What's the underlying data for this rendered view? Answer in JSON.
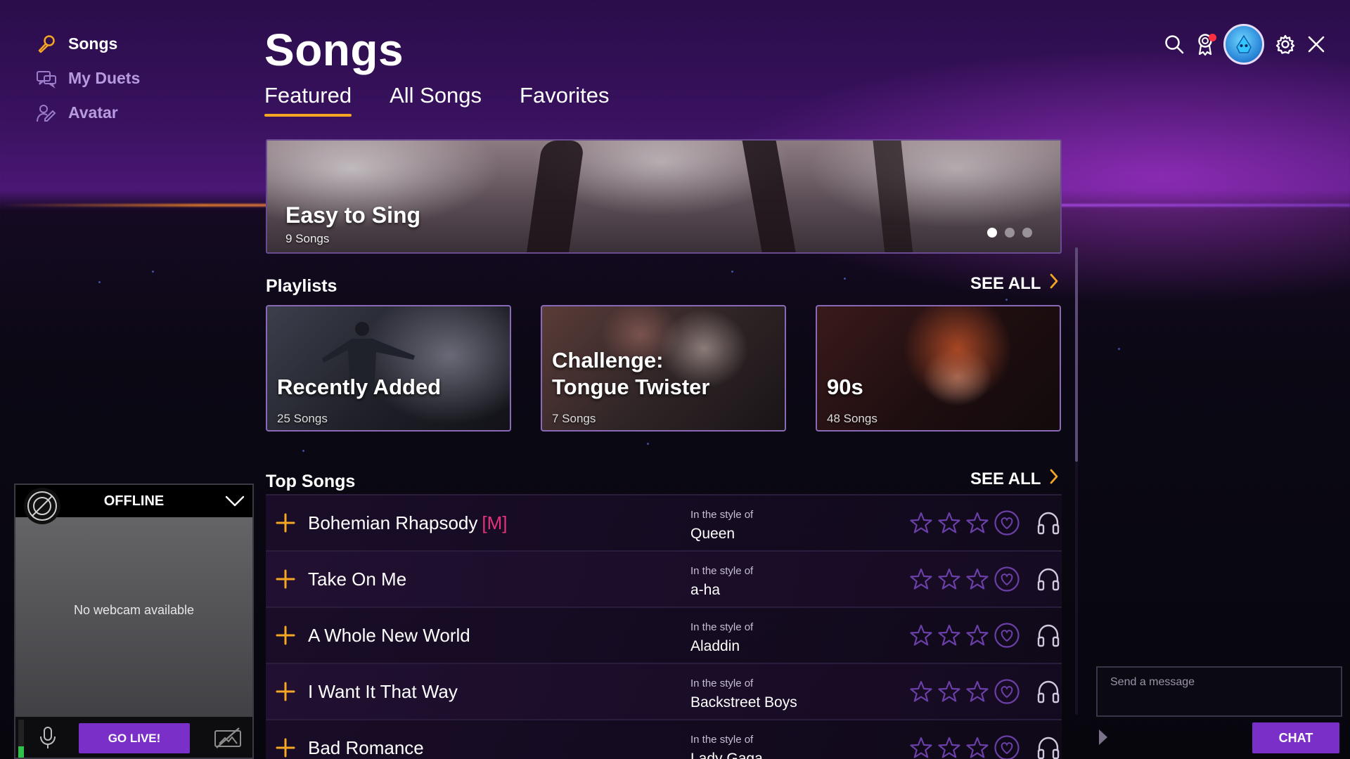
{
  "sidebar": {
    "items": [
      {
        "label": "Songs",
        "icon": "microphone-icon",
        "active": true
      },
      {
        "label": "My Duets",
        "icon": "duets-icon",
        "active": false
      },
      {
        "label": "Avatar",
        "icon": "avatar-edit-icon",
        "active": false
      }
    ]
  },
  "header": {
    "title": "Songs",
    "tabs": [
      {
        "label": "Featured",
        "active": true
      },
      {
        "label": "All Songs",
        "active": false
      },
      {
        "label": "Favorites",
        "active": false
      }
    ]
  },
  "toolbar": {
    "icons": [
      "search-icon",
      "achievements-icon",
      "profile-avatar",
      "settings-icon",
      "close-icon"
    ],
    "notification": true
  },
  "banner": {
    "title": "Easy to Sing",
    "subtitle": "9 Songs",
    "slide_count": 3,
    "active_slide": 1
  },
  "playlists": {
    "heading": "Playlists",
    "see_all": "SEE ALL",
    "cards": [
      {
        "title": "Recently Added",
        "subtitle": "25 Songs"
      },
      {
        "title_line1": "Challenge:",
        "title_line2": "Tongue Twister",
        "subtitle": "7 Songs"
      },
      {
        "title": "90s",
        "subtitle": "48 Songs"
      }
    ]
  },
  "top_songs": {
    "heading": "Top Songs",
    "see_all": "SEE ALL",
    "style_label": "In the style of",
    "rows": [
      {
        "title": "Bohemian Rhapsody",
        "tag": "[M]",
        "artist": "Queen"
      },
      {
        "title": "Take On Me",
        "tag": "",
        "artist": "a-ha"
      },
      {
        "title": "A Whole New World",
        "tag": "",
        "artist": "Aladdin"
      },
      {
        "title": "I Want It That Way",
        "tag": "",
        "artist": "Backstreet Boys"
      },
      {
        "title": "Bad Romance",
        "tag": "",
        "artist": "Lady Gaga"
      }
    ]
  },
  "webcam": {
    "status": "OFFLINE",
    "message": "No webcam available",
    "go_live": "GO LIVE!",
    "mic_level": 0.3
  },
  "chat": {
    "placeholder": "Send a message",
    "button": "CHAT"
  },
  "colors": {
    "accent": "#f5a623",
    "button": "#7a2fc8",
    "tag": "#e2337b",
    "icon_purple": "#6b3fa8"
  }
}
